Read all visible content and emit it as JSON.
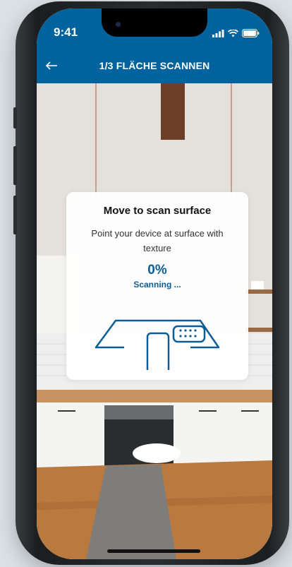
{
  "status_bar": {
    "time": "9:41",
    "icons": [
      "signal-icon",
      "wifi-icon",
      "battery-icon"
    ]
  },
  "header": {
    "title": "1/3 FLÄCHE SCANNEN",
    "back_icon": "arrow-left-icon"
  },
  "scan_card": {
    "title": "Move to scan surface",
    "subtitle": "Point your device at surface with texture",
    "progress_text": "0%",
    "status": "Scanning ...",
    "illustration": "phone-scanning-surface-icon"
  },
  "colors": {
    "brand_blue": "#00639d",
    "text_blue": "#0c5d95",
    "card_bg": "#ffffff"
  }
}
